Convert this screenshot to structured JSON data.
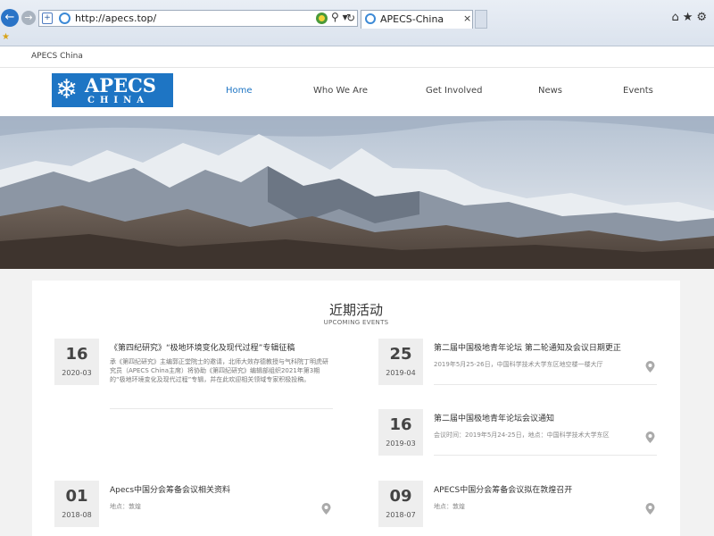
{
  "browser": {
    "back": "←",
    "forward": "→",
    "url": "http://apecs.top/",
    "tab_title": "APECS-China",
    "tab_close": "×",
    "search_icon": "⚲ ▾",
    "refresh_icon": "↻",
    "shield_icon": "+",
    "toolbar_icons": "⌂★⚙",
    "favorites_icon": "★"
  },
  "site": {
    "top_name": "APECS China",
    "logo_top": "APECS",
    "logo_bottom": "CHINA",
    "logo_flake": "❄",
    "nav": [
      "Home",
      "Who We Are",
      "Get Involved",
      "News",
      "Events"
    ],
    "active_color": "#1e75c4"
  },
  "events": {
    "title": "近期活动",
    "subtitle": "UPCOMING EVENTS",
    "items": [
      {
        "day": "16",
        "ym": "2020-03",
        "title": "《第四纪研究》“极地环境变化及现代过程”专辑征稿",
        "desc": "承《第四纪研究》主编郭正堂院士的邀请，北师大效存德教授与气科院丁明虎研究员（APECS China主席）将协助《第四纪研究》编辑部组织2021年第3期的“极地环境变化及现代过程”专辑，并在此欢迎相关领域专家积极投稿。"
      },
      {
        "day": "25",
        "ym": "2019-04",
        "title": "第二届中国极地青年论坛 第二轮通知及会议日期更正",
        "meta": "2019年5月25-26日，中国科学技术大学东区地空楼一楼大厅"
      },
      {
        "day": "16",
        "ym": "2019-03",
        "title": "第二届中国极地青年论坛会议通知",
        "meta": "会议时间：2019年5月24-25日，地点：中国科学技术大学东区"
      },
      {
        "day": "01",
        "ym": "2018-08",
        "title": "Apecs中国分会筹备会议相关资料",
        "meta": "地点：敦煌"
      },
      {
        "day": "09",
        "ym": "2018-07",
        "title": "APECS中国分会筹备会议拟在敦煌召开",
        "meta": "地点：敦煌"
      }
    ]
  }
}
